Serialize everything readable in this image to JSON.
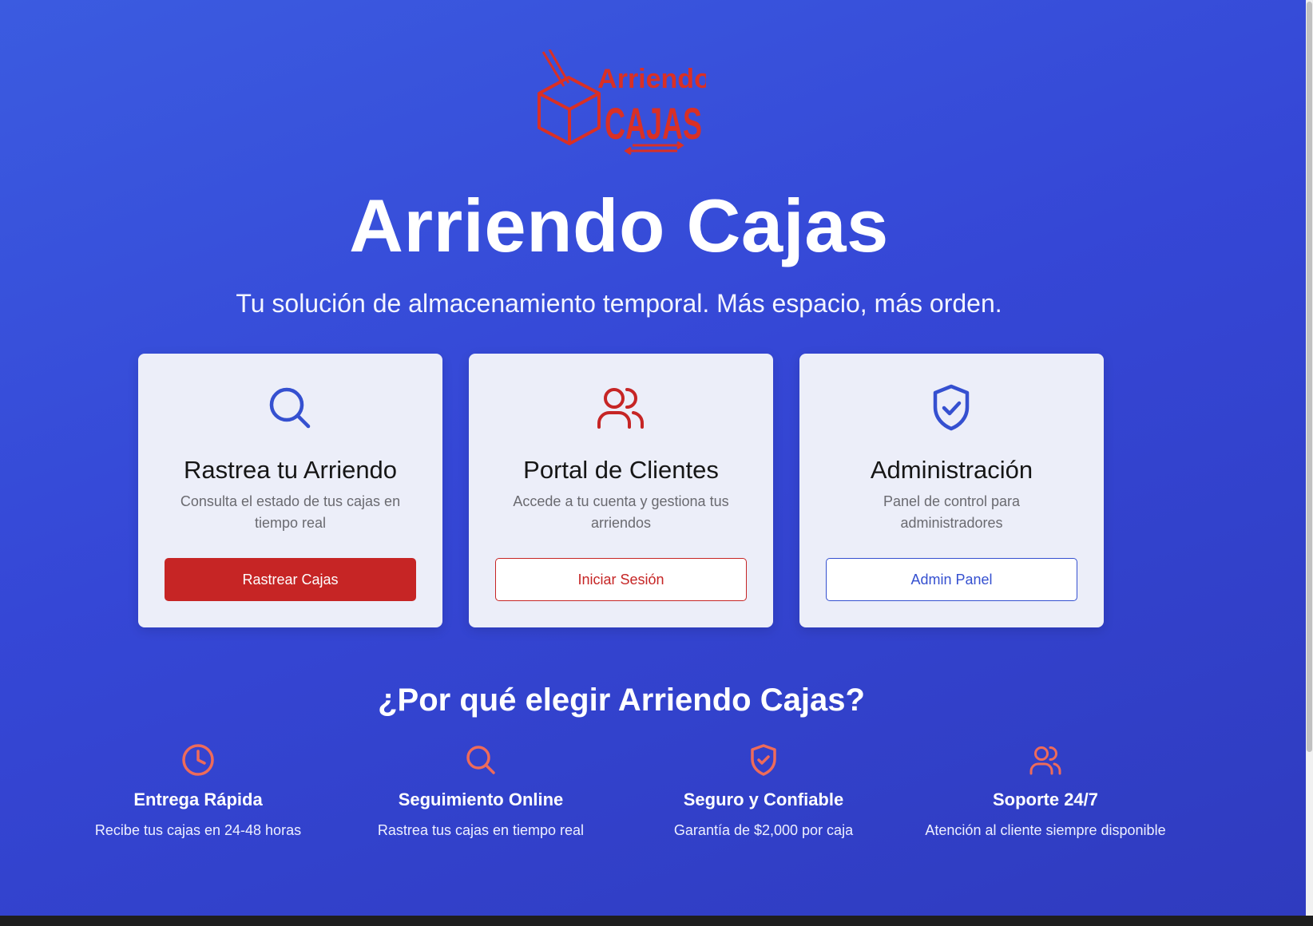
{
  "brand": {
    "logo_line1": "Arriendo",
    "logo_line2": "CAJAS",
    "logo_color": "#d93025"
  },
  "hero": {
    "title": "Arriendo Cajas",
    "subtitle": "Tu solución de almacenamiento temporal. Más espacio, más orden."
  },
  "cards": [
    {
      "icon": "search-icon",
      "title": "Rastrea tu Arriendo",
      "description": "Consulta el estado de tus cajas en tiempo real",
      "button": "Rastrear Cajas"
    },
    {
      "icon": "users-icon",
      "title": "Portal de Clientes",
      "description": "Accede a tu cuenta y gestiona tus arriendos",
      "button": "Iniciar Sesión"
    },
    {
      "icon": "shield-check-icon",
      "title": "Administración",
      "description": "Panel de control para administradores",
      "button": "Admin Panel"
    }
  ],
  "why": {
    "title": "¿Por qué elegir Arriendo Cajas?",
    "features": [
      {
        "icon": "clock-icon",
        "title": "Entrega Rápida",
        "description": "Recibe tus cajas en 24-48 horas"
      },
      {
        "icon": "search-icon",
        "title": "Seguimiento Online",
        "description": "Rastrea tus cajas en tiempo real"
      },
      {
        "icon": "shield-check-icon",
        "title": "Seguro y Confiable",
        "description": "Garantía de $2,000 por caja"
      },
      {
        "icon": "users-icon",
        "title": "Soporte 24/7",
        "description": "Atención al cliente siempre disponible"
      }
    ]
  },
  "colors": {
    "primary_blue": "#3550d0",
    "accent_red": "#c62525",
    "feature_icon": "#ee6b5a",
    "card_bg": "#eceef9"
  }
}
